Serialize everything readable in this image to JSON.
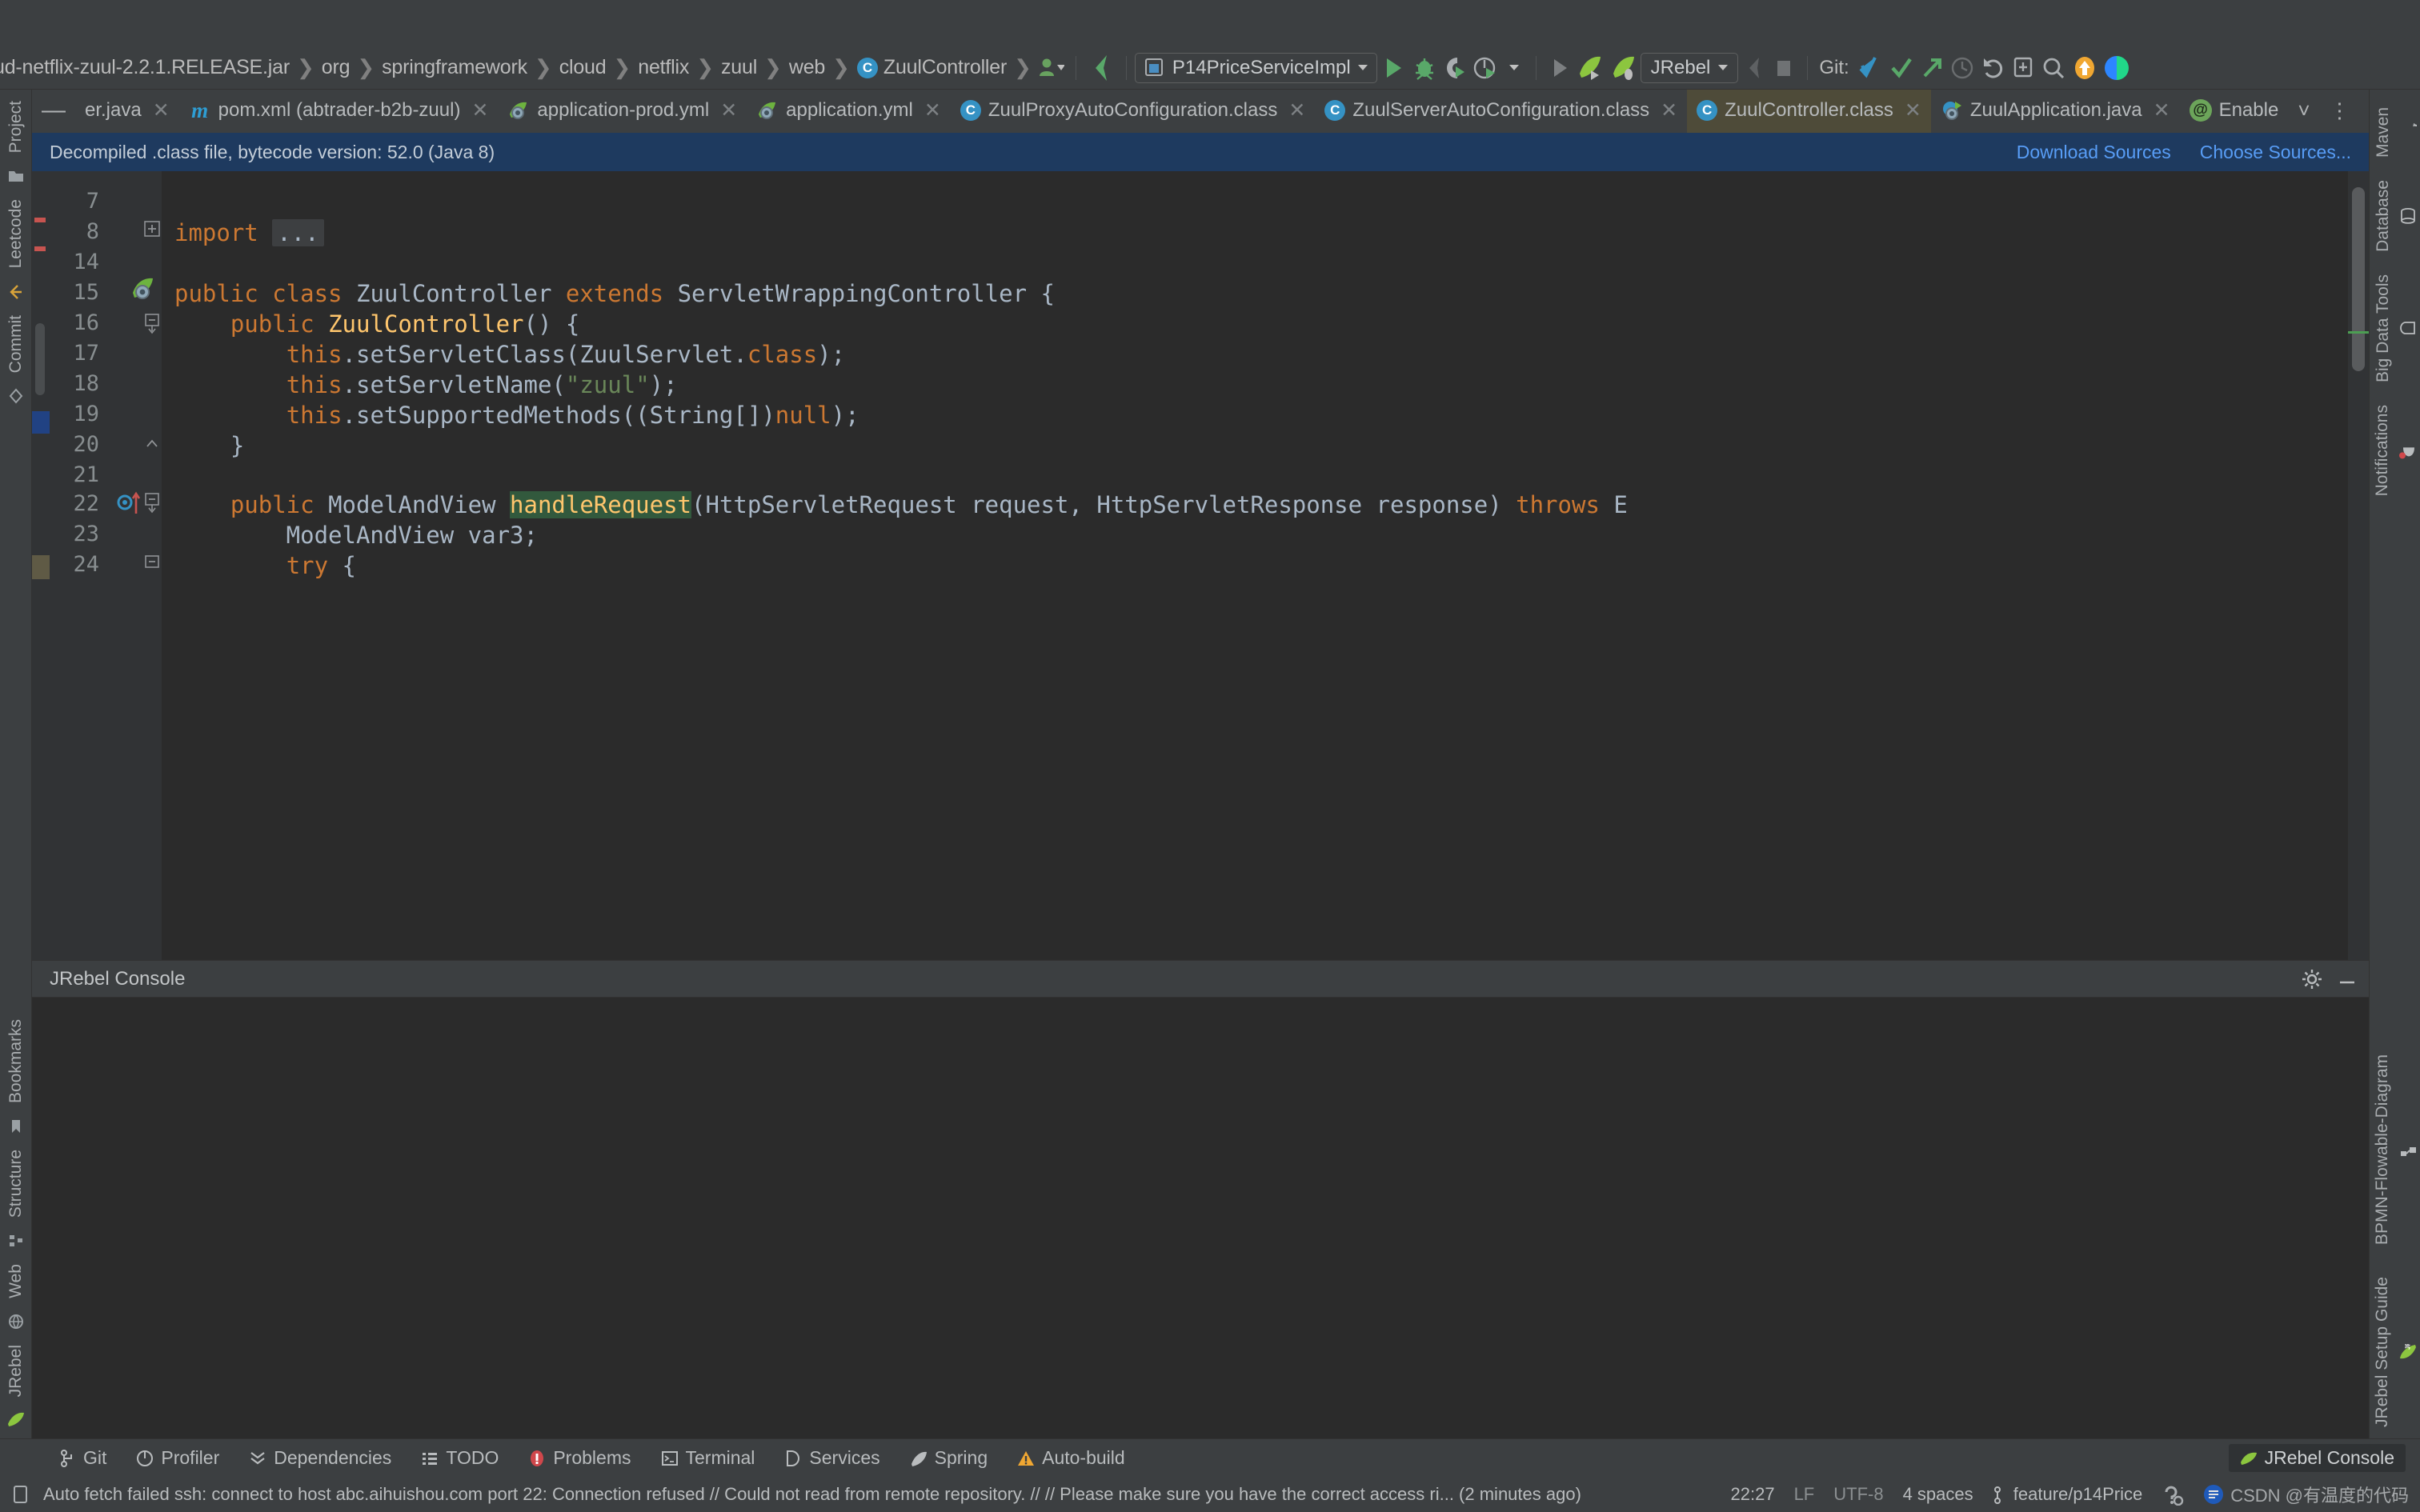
{
  "app": {
    "theme_bg": "#3c3f41",
    "editor_bg": "#2b2b2b",
    "accent": "#589df6"
  },
  "breadcrumb": {
    "items": [
      {
        "label": "ud-netflix-zuul-2.2.1.RELEASE.jar",
        "icon": "jar-icon"
      },
      {
        "label": "org",
        "icon": "folder-icon"
      },
      {
        "label": "springframework",
        "icon": "folder-icon"
      },
      {
        "label": "cloud",
        "icon": "folder-icon"
      },
      {
        "label": "netflix",
        "icon": "folder-icon"
      },
      {
        "label": "zuul",
        "icon": "folder-icon"
      },
      {
        "label": "web",
        "icon": "folder-icon"
      },
      {
        "label": "ZuulController",
        "icon": "class-icon"
      }
    ]
  },
  "toolbar": {
    "avatar_icon": "user-avatar-icon",
    "back_icon": "back-arrow-icon",
    "run_config": {
      "label": "P14PriceServiceImpl",
      "icon": "app-window-icon",
      "dropdown_icon": "chevron-down-icon"
    },
    "run_icon": "run-play-icon",
    "debug_icon": "debug-bug-icon",
    "run_coverage_icon": "run-with-coverage-icon",
    "profile_icon": "profiler-clock-icon",
    "profile_dropdown_icon": "chevron-down-icon",
    "rerun_icon": "rerun-play-icon",
    "jrebel_run_icon": "jrebel-run-icon",
    "jrebel_debug_icon": "jrebel-debug-icon",
    "jrebel_select": {
      "label": "JRebel",
      "dropdown_icon": "chevron-down-icon"
    },
    "attach_icon": "attach-profiler-icon",
    "stop_icon": "stop-square-icon",
    "git_label": "Git:",
    "git_update_icon": "git-update-arrow-icon",
    "git_commit_icon": "git-commit-check-icon",
    "git_push_icon": "git-push-arrow-icon",
    "git_history_icon": "git-history-clock-icon",
    "git_rollback_icon": "git-rollback-undo-icon",
    "new_window_icon": "new-window-icon",
    "search_icon": "search-everywhere-icon",
    "update_badge_icon": "update-available-icon",
    "ide_icon": "ide-logo-icon"
  },
  "tabs": {
    "collapse_icon": "minus-icon",
    "items": [
      {
        "label": "er.java",
        "icon": "java-class-icon",
        "close_icon": "close-icon",
        "state": "normal"
      },
      {
        "label": "pom.xml (abtrader-b2b-zuul)",
        "icon": "maven-icon",
        "close_icon": "close-icon",
        "state": "normal"
      },
      {
        "label": "application-prod.yml",
        "icon": "spring-yml-icon",
        "close_icon": "close-icon",
        "state": "normal"
      },
      {
        "label": "application.yml",
        "icon": "spring-yml-icon",
        "close_icon": "close-icon",
        "state": "normal"
      },
      {
        "label": "ZuulProxyAutoConfiguration.class",
        "icon": "class-icon",
        "close_icon": "close-icon",
        "state": "normal"
      },
      {
        "label": "ZuulServerAutoConfiguration.class",
        "icon": "class-icon",
        "close_icon": "close-icon",
        "state": "normal"
      },
      {
        "label": "ZuulController.class",
        "icon": "class-icon",
        "close_icon": "close-icon",
        "state": "active"
      },
      {
        "label": "ZuulApplication.java",
        "icon": "spring-java-icon",
        "close_icon": "close-icon",
        "state": "normal"
      },
      {
        "label": "Enable",
        "icon": "annotation-icon",
        "close_icon": "close-icon",
        "state": "truncated"
      }
    ],
    "overflow_icon": "chevron-down-icon",
    "more_icon": "more-vertical-icon",
    "maven_icon": "maven-icon"
  },
  "notification": {
    "message": "Decompiled .class file, bytecode version: 52.0 (Java 8)",
    "download_sources": "Download Sources",
    "choose_sources": "Choose Sources..."
  },
  "editor": {
    "lines": [
      {
        "num": "7",
        "tokens": []
      },
      {
        "num": "8",
        "tokens": [
          {
            "t": "import ",
            "c": "kw"
          },
          {
            "t": "...",
            "c": "ellipsis"
          }
        ],
        "fold": "plus"
      },
      {
        "num": "14",
        "tokens": []
      },
      {
        "num": "15",
        "tokens": [
          {
            "t": "public ",
            "c": "kw"
          },
          {
            "t": "class ",
            "c": "kw"
          },
          {
            "t": "ZuulController ",
            "c": "id"
          },
          {
            "t": "extends ",
            "c": "kw"
          },
          {
            "t": "ServletWrappingController {",
            "c": "id"
          }
        ],
        "gutter_icon": "spring-bean-icon"
      },
      {
        "num": "16",
        "tokens": [
          {
            "t": "    ",
            "c": "id"
          },
          {
            "t": "public ",
            "c": "kw"
          },
          {
            "t": "ZuulController",
            "c": "fn"
          },
          {
            "t": "() {",
            "c": "id"
          }
        ],
        "fold": "minus"
      },
      {
        "num": "17",
        "tokens": [
          {
            "t": "        ",
            "c": "id"
          },
          {
            "t": "this",
            "c": "kw"
          },
          {
            "t": ".setServletClass(ZuulServlet.",
            "c": "id"
          },
          {
            "t": "class",
            "c": "kw"
          },
          {
            "t": ");",
            "c": "id"
          }
        ]
      },
      {
        "num": "18",
        "tokens": [
          {
            "t": "        ",
            "c": "id"
          },
          {
            "t": "this",
            "c": "kw"
          },
          {
            "t": ".setServletName(",
            "c": "id"
          },
          {
            "t": "\"zuul\"",
            "c": "str"
          },
          {
            "t": ");",
            "c": "id"
          }
        ]
      },
      {
        "num": "19",
        "tokens": [
          {
            "t": "        ",
            "c": "id"
          },
          {
            "t": "this",
            "c": "kw"
          },
          {
            "t": ".setSupportedMethods((String[])",
            "c": "id"
          },
          {
            "t": "null",
            "c": "kw"
          },
          {
            "t": ");",
            "c": "id"
          }
        ]
      },
      {
        "num": "20",
        "tokens": [
          {
            "t": "    }",
            "c": "id"
          }
        ],
        "fold": "end"
      },
      {
        "num": "21",
        "tokens": []
      },
      {
        "num": "22",
        "tokens": [
          {
            "t": "    ",
            "c": "id"
          },
          {
            "t": "public ",
            "c": "kw"
          },
          {
            "t": "ModelAndView ",
            "c": "id"
          },
          {
            "t": "handleRequest",
            "c": "hl"
          },
          {
            "t": "(HttpServletRequest request, HttpServletResponse response) ",
            "c": "id"
          },
          {
            "t": "throws ",
            "c": "kw"
          },
          {
            "t": "E",
            "c": "id"
          }
        ],
        "gutter_icon": "override-method-icon",
        "bulb": true,
        "fold": "minus"
      },
      {
        "num": "23",
        "tokens": [
          {
            "t": "        ModelAndView var3;",
            "c": "id"
          }
        ]
      },
      {
        "num": "24",
        "tokens": [
          {
            "t": "        ",
            "c": "id"
          },
          {
            "t": "try ",
            "c": "kw"
          },
          {
            "t": "{",
            "c": "id"
          }
        ],
        "fold": "minus"
      }
    ]
  },
  "console": {
    "title": "JRebel Console",
    "settings_icon": "gear-icon",
    "minimize_icon": "minimize-icon"
  },
  "left_strip": {
    "items": [
      {
        "label": "Project",
        "icon": "project-icon"
      },
      {
        "label": "Leetcode",
        "icon": "leetcode-icon"
      },
      {
        "label": "Commit",
        "icon": "commit-icon"
      },
      {
        "label": "Bookmarks",
        "icon": "bookmarks-icon"
      },
      {
        "label": "Structure",
        "icon": "structure-icon"
      },
      {
        "label": "Web",
        "icon": "web-icon"
      },
      {
        "label": "JRebel",
        "icon": "jrebel-icon"
      }
    ]
  },
  "right_strip": {
    "items": [
      {
        "label": "Maven",
        "icon": "maven-icon"
      },
      {
        "label": "Database",
        "icon": "database-icon"
      },
      {
        "label": "Big Data Tools",
        "icon": "big-data-tools-icon"
      },
      {
        "label": "Notifications",
        "icon": "notifications-bell-icon"
      },
      {
        "label": "BPMN-Flowable-Diagram",
        "icon": "bpmn-diagram-icon"
      },
      {
        "label": "JRebel Setup Guide",
        "icon": "jrebel-icon"
      }
    ]
  },
  "bottom_bar": {
    "items": [
      {
        "label": "Git",
        "icon": "git-branch-icon"
      },
      {
        "label": "Profiler",
        "icon": "profiler-icon"
      },
      {
        "label": "Dependencies",
        "icon": "dependencies-icon"
      },
      {
        "label": "TODO",
        "icon": "todo-list-icon"
      },
      {
        "label": "Problems",
        "icon": "problems-error-icon"
      },
      {
        "label": "Terminal",
        "icon": "terminal-icon"
      },
      {
        "label": "Services",
        "icon": "services-icon"
      },
      {
        "label": "Spring",
        "icon": "spring-leaf-icon"
      },
      {
        "label": "Auto-build",
        "icon": "auto-build-warning-icon"
      }
    ],
    "right_pill": {
      "label": "JRebel Console",
      "icon": "jrebel-icon"
    }
  },
  "status_bar": {
    "icon": "status-message-icon",
    "message": "Auto fetch failed ssh: connect to host abc.aihuishou.com port 22: Connection refused // Could not read from remote repository. // // Please make sure you have the correct access ri... (2 minutes ago)",
    "position": "22:27",
    "line_separator": "LF",
    "encoding": "UTF-8",
    "indent": "4 spaces",
    "branch": "feature/p14Price",
    "branch_icon": "git-branch-icon",
    "inspection_icon": "inspection-widget-icon",
    "csdn_badge": "CSDN @有温度的代码"
  }
}
